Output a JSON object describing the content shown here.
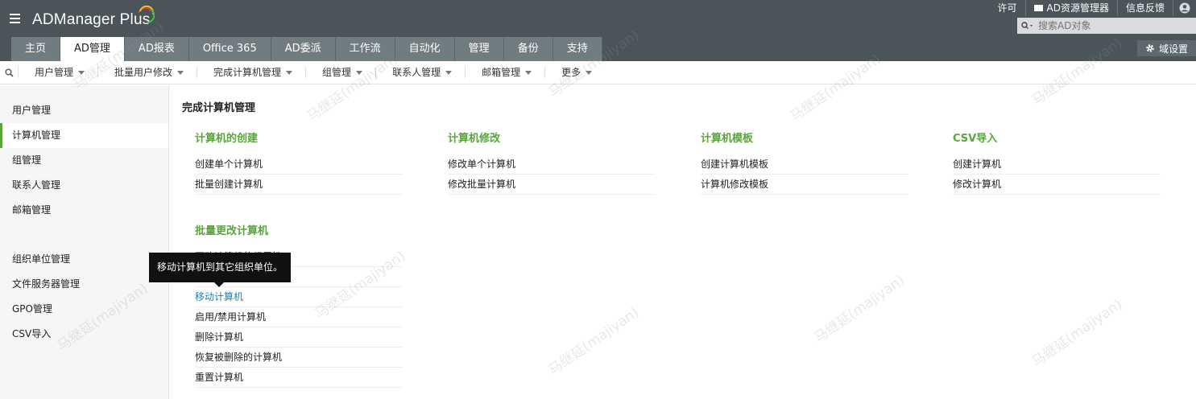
{
  "header": {
    "logo_text": "ADManager Plus",
    "top_links": {
      "license": "许可",
      "ad_explorer": "AD资源管理器",
      "feedback": "信息反馈"
    },
    "search_placeholder": "搜索AD对象",
    "domain_settings": "域设置",
    "tabs": [
      "主页",
      "AD管理",
      "AD报表",
      "Office 365",
      "AD委派",
      "工作流",
      "自动化",
      "管理",
      "备份",
      "支持"
    ],
    "active_tab": "AD管理"
  },
  "subnav": {
    "items": [
      "用户管理",
      "批量用户修改",
      "完成计算机管理",
      "组管理",
      "联系人管理",
      "邮箱管理",
      "更多"
    ]
  },
  "sidebar": {
    "items_top": [
      "用户管理",
      "计算机管理",
      "组管理",
      "联系人管理",
      "邮箱管理"
    ],
    "items_bottom": [
      "组织单位管理",
      "文件服务器管理",
      "GPO管理",
      "CSV导入"
    ],
    "active": "计算机管理"
  },
  "main": {
    "title": "完成计算机管理",
    "sections": [
      {
        "title": "计算机的创建",
        "links": [
          "创建单个计算机",
          "批量创建计算机"
        ]
      },
      {
        "title": "计算机修改",
        "links": [
          "修改单个计算机",
          "修改批量计算机"
        ]
      },
      {
        "title": "计算机模板",
        "links": [
          "创建计算机模板",
          "计算机修改模板"
        ]
      },
      {
        "title": "CSV导入",
        "links": [
          "创建计算机",
          "修改计算机"
        ]
      },
      {
        "title": "批量更改计算机",
        "links": [
          "更改计算机的组属性",
          "",
          "移动计算机",
          "启用/禁用计算机",
          "删除计算机",
          "恢复被删除的计算机",
          "重置计算机"
        ]
      }
    ],
    "tooltip": "移动计算机到其它组织单位。",
    "highlighted_link": "移动计算机"
  },
  "watermark": "马继延(majiyan)",
  "colors": {
    "header_bg": "#4a5459",
    "tab_bg": "#717c81",
    "accent_green": "#59a53c",
    "link_blue": "#1d7fb4"
  }
}
